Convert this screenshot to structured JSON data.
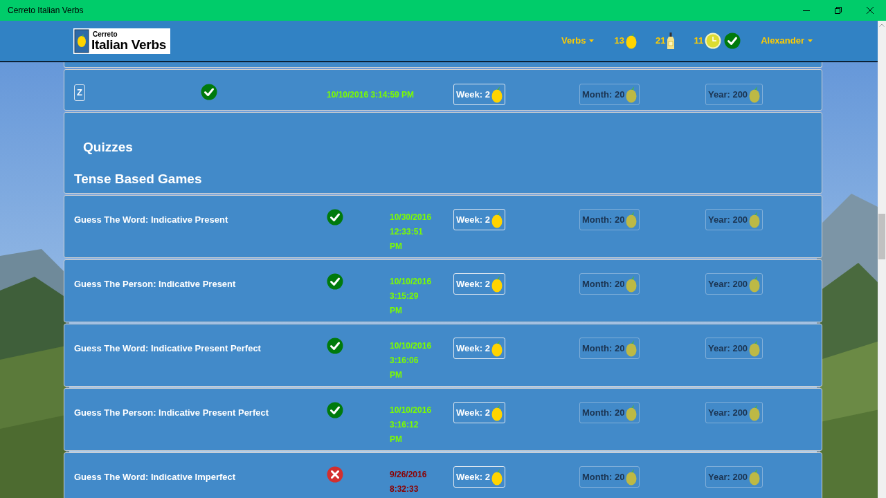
{
  "window": {
    "title": "Cerreto Italian Verbs"
  },
  "header": {
    "logo": {
      "small": "Cerreto",
      "big": "Italian Verbs"
    },
    "nav": [
      {
        "kind": "menu",
        "label": "Verbs"
      },
      {
        "kind": "lemon",
        "label": "13"
      },
      {
        "kind": "bottle",
        "label": "21"
      },
      {
        "kind": "clock",
        "label": "11"
      },
      {
        "kind": "menu",
        "label": "Alexander"
      }
    ]
  },
  "letter_row": {
    "letter": "Z",
    "done": true,
    "date": "10/10/2016 3:14:59 PM",
    "badges": [
      {
        "label": "Week: 2",
        "active": true
      },
      {
        "label": "Month: 20",
        "active": false
      },
      {
        "label": "Year: 200",
        "active": false
      }
    ]
  },
  "section": {
    "title": "Quizzes",
    "subtitle": "Tense Based Games"
  },
  "games": [
    {
      "name": "Guess The Word: Indicative Present",
      "done": true,
      "date": "10/30/2016 12:33:51 PM",
      "badges": [
        {
          "label": "Week: 2",
          "active": true
        },
        {
          "label": "Month: 20",
          "active": false
        },
        {
          "label": "Year: 200",
          "active": false
        }
      ]
    },
    {
      "name": "Guess The Person: Indicative Present",
      "done": true,
      "date": "10/10/2016 3:15:29 PM",
      "badges": [
        {
          "label": "Week: 2",
          "active": true
        },
        {
          "label": "Month: 20",
          "active": false
        },
        {
          "label": "Year: 200",
          "active": false
        }
      ]
    },
    {
      "name": "Guess The Word: Indicative Present Perfect",
      "done": true,
      "date": "10/10/2016 3:16:06 PM",
      "badges": [
        {
          "label": "Week: 2",
          "active": true
        },
        {
          "label": "Month: 20",
          "active": false
        },
        {
          "label": "Year: 200",
          "active": false
        }
      ]
    },
    {
      "name": "Guess The Person: Indicative Present Perfect",
      "done": true,
      "date": "10/10/2016 3:16:12 PM",
      "badges": [
        {
          "label": "Week: 2",
          "active": true
        },
        {
          "label": "Month: 20",
          "active": false
        },
        {
          "label": "Year: 200",
          "active": false
        }
      ]
    },
    {
      "name": "Guess The Word: Indicative Imperfect",
      "done": false,
      "date": "9/26/2016 8:32:33",
      "badges": [
        {
          "label": "Week: 2",
          "active": true
        },
        {
          "label": "Month: 20",
          "active": false
        },
        {
          "label": "Year: 200",
          "active": false
        }
      ]
    }
  ]
}
